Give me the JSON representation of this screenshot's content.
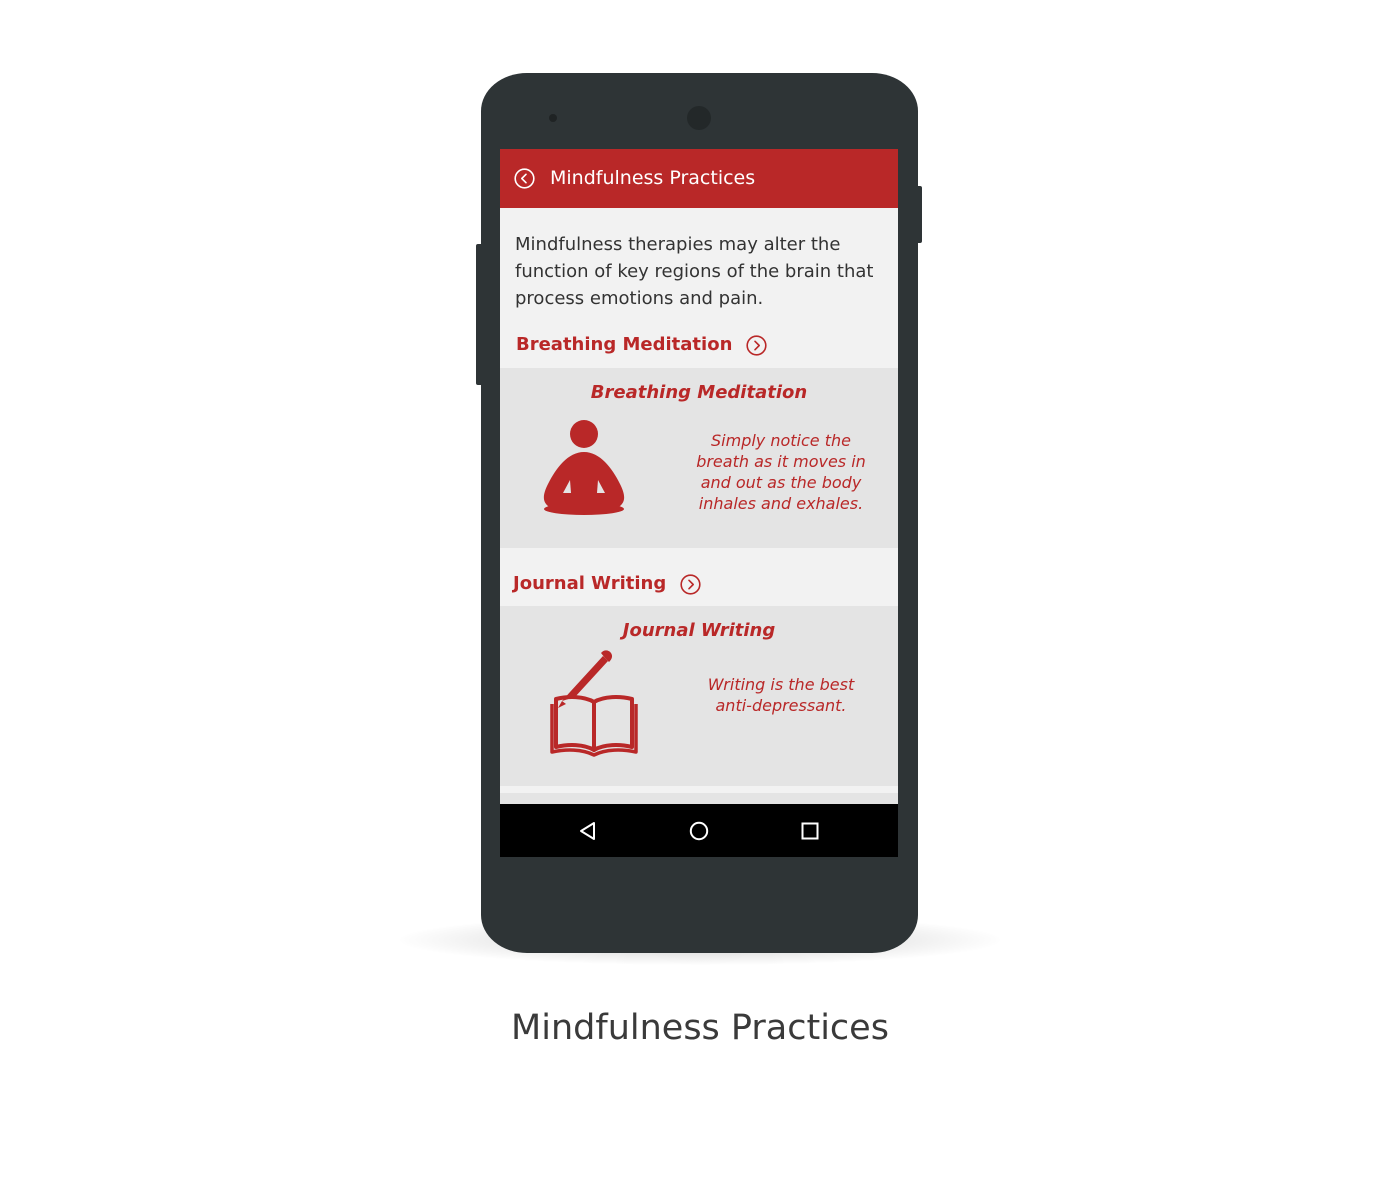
{
  "app": {
    "title": "Mindfulness Practices",
    "accent_color": "#b92828"
  },
  "intro": {
    "text": "Mindfulness therapies may alter the function of key regions of the brain that process emotions and pain."
  },
  "sections": [
    {
      "link_label": "Breathing Meditation",
      "card_title": "Breathing Meditation",
      "card_text": "Simply notice the breath as it moves in and out as the body inhales and exhales.",
      "icon": "meditation-icon"
    },
    {
      "link_label": "Journal Writing",
      "card_title": "Journal Writing",
      "card_text": "Writing is the best anti-depressant.",
      "icon": "journal-pen-icon"
    }
  ],
  "navbar": {
    "icons": [
      "back-triangle-icon",
      "home-circle-icon",
      "recent-square-icon"
    ]
  },
  "caption": "Mindfulness Practices"
}
